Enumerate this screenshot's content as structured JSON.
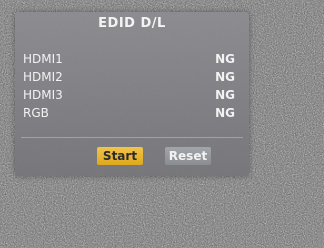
{
  "menu": {
    "title": "EDID D/L",
    "rows": [
      {
        "label": "HDMI1",
        "status": "NG"
      },
      {
        "label": "HDMI2",
        "status": "NG"
      },
      {
        "label": "HDMI3",
        "status": "NG"
      },
      {
        "label": "RGB",
        "status": "NG"
      }
    ],
    "buttons": {
      "start_label": "Start",
      "reset_label": "Reset"
    }
  },
  "colors": {
    "panel": "#7c7c80",
    "text": "#f2f2f2",
    "start_button": "#e8b52c",
    "reset_button": "#9a9ea2",
    "screen_noise": "#6b6b6b"
  }
}
